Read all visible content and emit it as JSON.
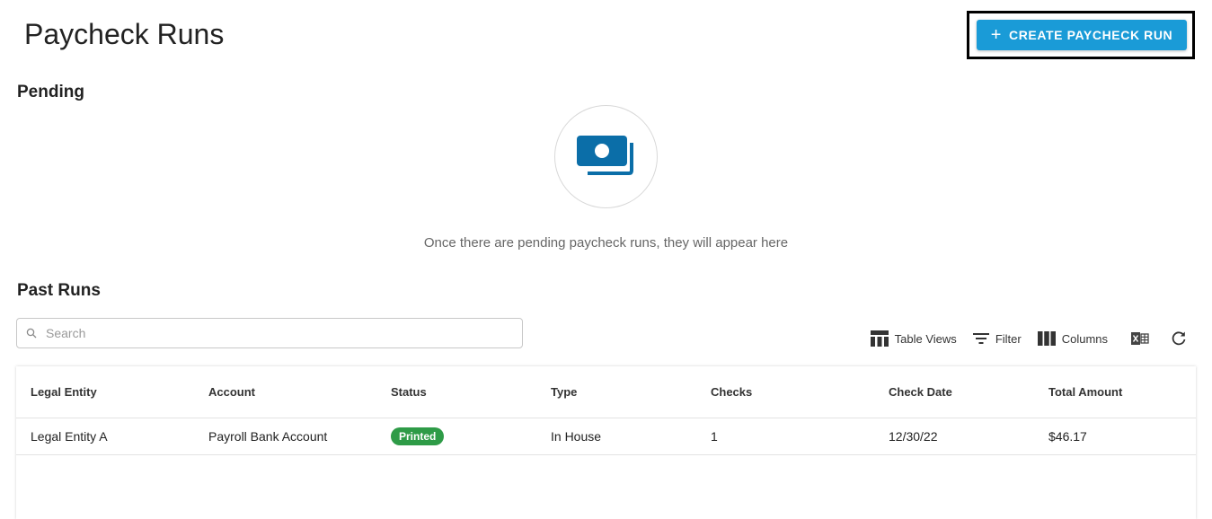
{
  "header": {
    "title": "Paycheck Runs",
    "create_button_label": "CREATE PAYCHECK RUN",
    "create_button_icon": "plus-icon"
  },
  "pending": {
    "title": "Pending",
    "empty_icon": "money-stack-icon",
    "empty_message": "Once there are pending paycheck runs, they will appear here"
  },
  "past_runs": {
    "title": "Past Runs",
    "search_placeholder": "Search",
    "toolbar": {
      "table_views": "Table Views",
      "filter": "Filter",
      "columns": "Columns"
    },
    "columns": [
      "Legal Entity",
      "Account",
      "Status",
      "Type",
      "Checks",
      "Check Date",
      "Total Amount"
    ],
    "rows": [
      {
        "legal_entity": "Legal Entity A",
        "account": "Payroll Bank Account",
        "status": "Printed",
        "type": "In House",
        "checks": "1",
        "check_date": "12/30/22",
        "total_amount": "$46.17"
      }
    ]
  },
  "colors": {
    "accent": "#1a9bd7",
    "icon_blue": "#0b6ea8",
    "status_printed": "#2e9b47"
  }
}
